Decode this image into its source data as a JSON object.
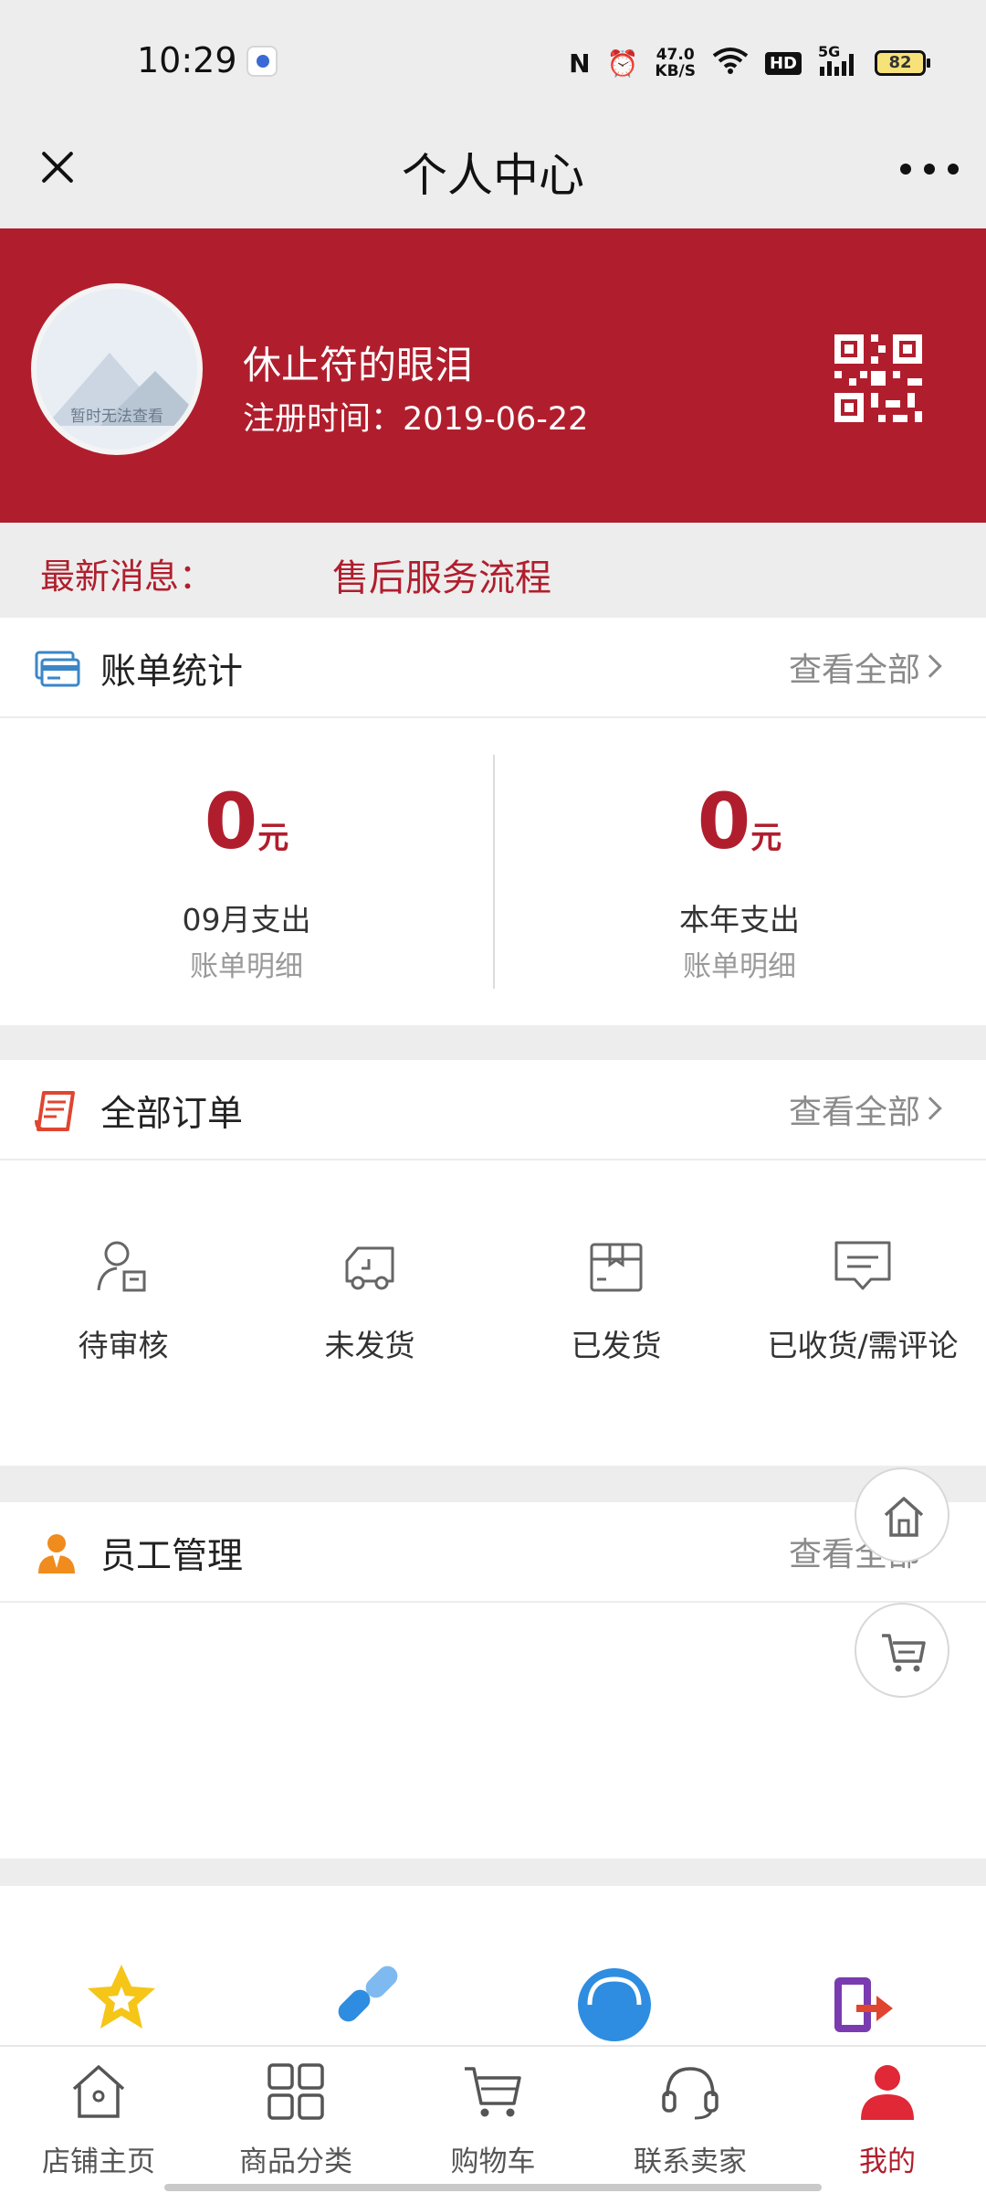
{
  "status_bar": {
    "time": "10:29",
    "network_speed": "47.0\nKB/S",
    "hd": "HD",
    "signal": "5G",
    "battery": "82"
  },
  "title_bar": {
    "title": "个人中心"
  },
  "profile": {
    "avatar_placeholder": "暂时无法查看",
    "name": "休止符的眼泪",
    "register_label": "注册时间：2019-06-22"
  },
  "news": {
    "label": "最新消息：",
    "text": "售后服务流程"
  },
  "bills": {
    "title": "账单统计",
    "view_all": "查看全部",
    "items": [
      {
        "amount": "0",
        "unit": "元",
        "label": "09月支出",
        "sub": "账单明细"
      },
      {
        "amount": "0",
        "unit": "元",
        "label": "本年支出",
        "sub": "账单明细"
      }
    ]
  },
  "orders": {
    "title": "全部订单",
    "view_all": "查看全部",
    "items": [
      {
        "label": "待审核",
        "icon": "user-review-icon"
      },
      {
        "label": "未发货",
        "icon": "truck-icon"
      },
      {
        "label": "已发货",
        "icon": "box-icon"
      },
      {
        "label": "已收货/需评论",
        "icon": "comment-icon"
      }
    ]
  },
  "staff": {
    "title": "员工管理",
    "view_all": "查看全部"
  },
  "tabs": [
    {
      "label": "店铺主页",
      "icon": "home-icon"
    },
    {
      "label": "商品分类",
      "icon": "grid-icon"
    },
    {
      "label": "购物车",
      "icon": "cart-icon"
    },
    {
      "label": "联系卖家",
      "icon": "headset-icon"
    },
    {
      "label": "我的",
      "icon": "user-icon"
    }
  ],
  "colors": {
    "brand": "#b01e2d",
    "background": "#ededed"
  }
}
